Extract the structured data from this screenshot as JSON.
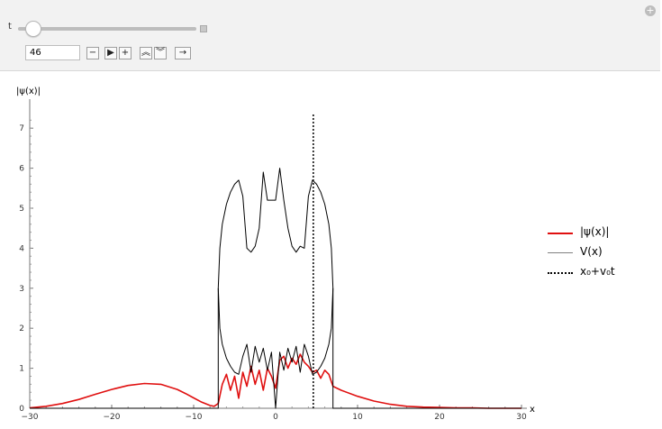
{
  "controls": {
    "t_label": "t",
    "slider_fraction": 0.08,
    "t_value": "46",
    "corner_icon": "plus-icon",
    "buttons": [
      {
        "name": "step-back-button",
        "icon": "minus-icon",
        "glyph": "−"
      },
      {
        "name": "play-button",
        "icon": "play-icon",
        "glyph": "▶"
      },
      {
        "name": "step-forward-button",
        "icon": "plus-icon",
        "glyph": "+"
      },
      {
        "name": "faster-button",
        "icon": "double-chevron-up-icon",
        "glyph": "⌃"
      },
      {
        "name": "slower-button",
        "icon": "double-chevron-down-icon",
        "glyph": "⌄"
      },
      {
        "name": "direction-button",
        "icon": "arrow-right-icon",
        "glyph": "→"
      }
    ]
  },
  "chart_data": {
    "type": "line",
    "ylabel": "|ψ(x)|",
    "xlabel": "x",
    "xlim": [
      -30,
      30
    ],
    "ylim": [
      0,
      7.5
    ],
    "xticks": [
      -30,
      -20,
      -10,
      0,
      10,
      20,
      30
    ],
    "yticks": [
      0,
      1,
      2,
      3,
      4,
      5,
      6,
      7
    ],
    "legend_position": "right",
    "colors": {
      "psi": "#e01010",
      "potential": "#000000",
      "marker": "#000000"
    },
    "series": [
      {
        "name": "|ψ(x)|",
        "x": [
          -30,
          -28,
          -26,
          -24,
          -22,
          -20,
          -18,
          -16,
          -14,
          -12,
          -11,
          -10,
          -9,
          -8,
          -7.5,
          -7,
          -6.5,
          -6,
          -5.5,
          -5,
          -4.5,
          -4,
          -3.5,
          -3,
          -2.5,
          -2,
          -1.5,
          -1,
          -0.5,
          0,
          0.5,
          1,
          1.5,
          2,
          2.5,
          3,
          3.5,
          4,
          4.5,
          5,
          5.5,
          6,
          6.5,
          7,
          8,
          10,
          12,
          14,
          16,
          18,
          20,
          22,
          24,
          26,
          28,
          30
        ],
        "y": [
          0.01,
          0.05,
          0.12,
          0.22,
          0.35,
          0.47,
          0.57,
          0.62,
          0.6,
          0.47,
          0.37,
          0.26,
          0.15,
          0.07,
          0.05,
          0.12,
          0.6,
          0.85,
          0.45,
          0.8,
          0.25,
          0.9,
          0.55,
          1.05,
          0.6,
          0.95,
          0.45,
          1.0,
          0.8,
          0.5,
          1.2,
          1.3,
          1.0,
          1.25,
          1.1,
          1.35,
          1.15,
          1.05,
          0.9,
          0.95,
          0.75,
          0.95,
          0.85,
          0.55,
          0.45,
          0.3,
          0.18,
          0.1,
          0.05,
          0.03,
          0.02,
          0.01,
          0.01,
          0.0,
          0.0,
          0.0
        ]
      },
      {
        "name": "V(x)",
        "x": [
          -30,
          -7,
          -7,
          -6.8,
          -6.5,
          -6,
          -5.5,
          -5,
          -4.5,
          -4,
          -3.5,
          -3,
          -2.5,
          -2,
          -1.5,
          -1,
          -0.5,
          0,
          0.5,
          1,
          1.5,
          2,
          2.5,
          3,
          3.5,
          4,
          4.5,
          5,
          5.5,
          6,
          6.5,
          6.8,
          7,
          7,
          30
        ],
        "y": [
          0,
          0,
          3,
          4,
          4.6,
          5.1,
          5.4,
          5.6,
          5.7,
          5.3,
          4.0,
          3.9,
          4.05,
          4.5,
          5.9,
          5.2,
          5.2,
          5.2,
          6.0,
          5.2,
          4.5,
          4.05,
          3.9,
          4.05,
          4.0,
          5.3,
          5.7,
          5.6,
          5.4,
          5.1,
          4.6,
          4.0,
          3,
          0,
          0
        ]
      },
      {
        "name": "V(x)",
        "x": [
          -7,
          -6.8,
          -6.5,
          -6,
          -5.5,
          -5,
          -4.5,
          -4,
          -3.5,
          -3,
          -2.5,
          -2,
          -1.5,
          -1,
          -0.5,
          0,
          0.5,
          1,
          1.5,
          2,
          2.5,
          3,
          3.5,
          4,
          4.5,
          5,
          5.5,
          6,
          6.5,
          6.8,
          7
        ],
        "y": [
          3,
          2.0,
          1.6,
          1.25,
          1.05,
          0.9,
          0.85,
          1.3,
          1.6,
          0.9,
          1.55,
          1.15,
          1.5,
          0.95,
          1.4,
          0.0,
          1.4,
          0.95,
          1.5,
          1.15,
          1.55,
          0.9,
          1.6,
          1.3,
          0.85,
          0.9,
          1.05,
          1.25,
          1.6,
          2.0,
          3
        ]
      }
    ],
    "marker": {
      "name": "x₀+v₀t",
      "x": 4.6
    }
  },
  "legend": [
    {
      "label": "|ψ(x)|",
      "color": "#e01010",
      "style": "solid"
    },
    {
      "label": "V(x)",
      "color": "#808080",
      "style": "solid"
    },
    {
      "label": "x₀+v₀t",
      "color": "#000000",
      "style": "dotted"
    }
  ]
}
